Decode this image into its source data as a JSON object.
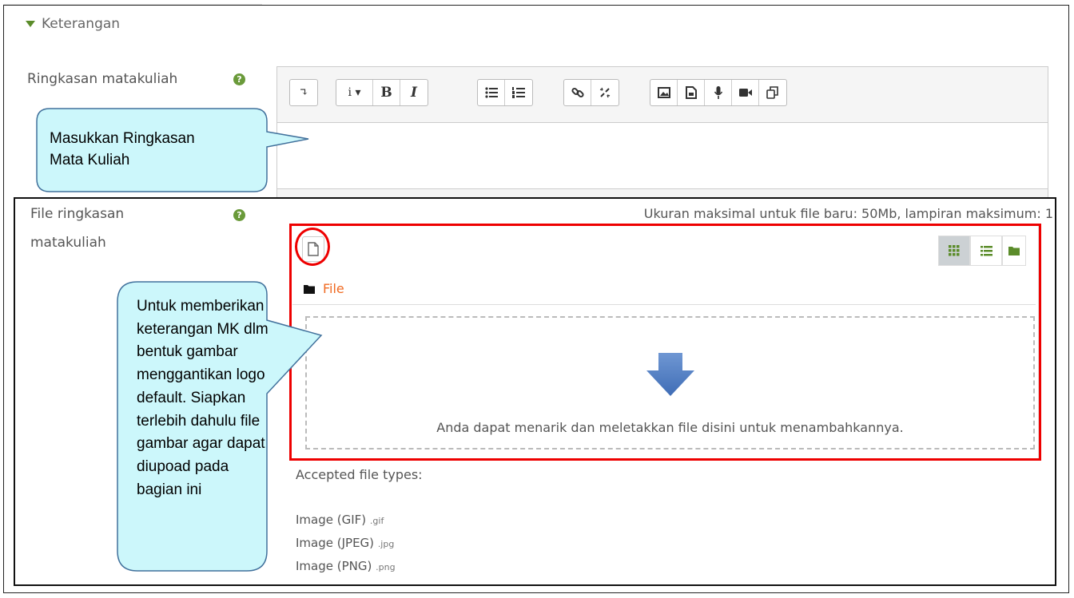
{
  "section": {
    "title": "Keterangan"
  },
  "summary_field": {
    "label": "Ringkasan matakuliah"
  },
  "editor_toolbar": {
    "buttons": [
      "↴",
      "i ▾",
      "B",
      "I"
    ]
  },
  "file_field": {
    "label_line1": "File ringkasan",
    "label_line2": "matakuliah",
    "limits": "Ukuran maksimal untuk file baru: 50Mb, lampiran maksimum: 1",
    "path_label": "File",
    "drop_text": "Anda dapat menarik dan meletakkan file disini untuk menambahkannya.",
    "accepted_title": "Accepted file types:",
    "types": [
      {
        "name": "Image (GIF)",
        "ext": ".gif"
      },
      {
        "name": "Image (JPEG)",
        "ext": ".jpg"
      },
      {
        "name": "Image (PNG)",
        "ext": ".png"
      }
    ]
  },
  "callouts": {
    "summary": [
      "Masukkan Ringkasan",
      "Mata Kuliah"
    ],
    "file": [
      "Untuk memberikan",
      "keterangan MK dlm",
      "bentuk gambar",
      "menggantikan logo",
      "default. Siapkan",
      "terlebih dahulu file",
      "gambar agar dapat",
      "diupoad pada",
      "bagian ini"
    ]
  },
  "colors": {
    "accent_green": "#6a9a3a",
    "link_orange": "#f06a22",
    "highlight_red": "#e00000",
    "callout_fill": "#ccf7fb",
    "callout_stroke": "#41719c",
    "arrow_blue": "#4f81bd"
  }
}
